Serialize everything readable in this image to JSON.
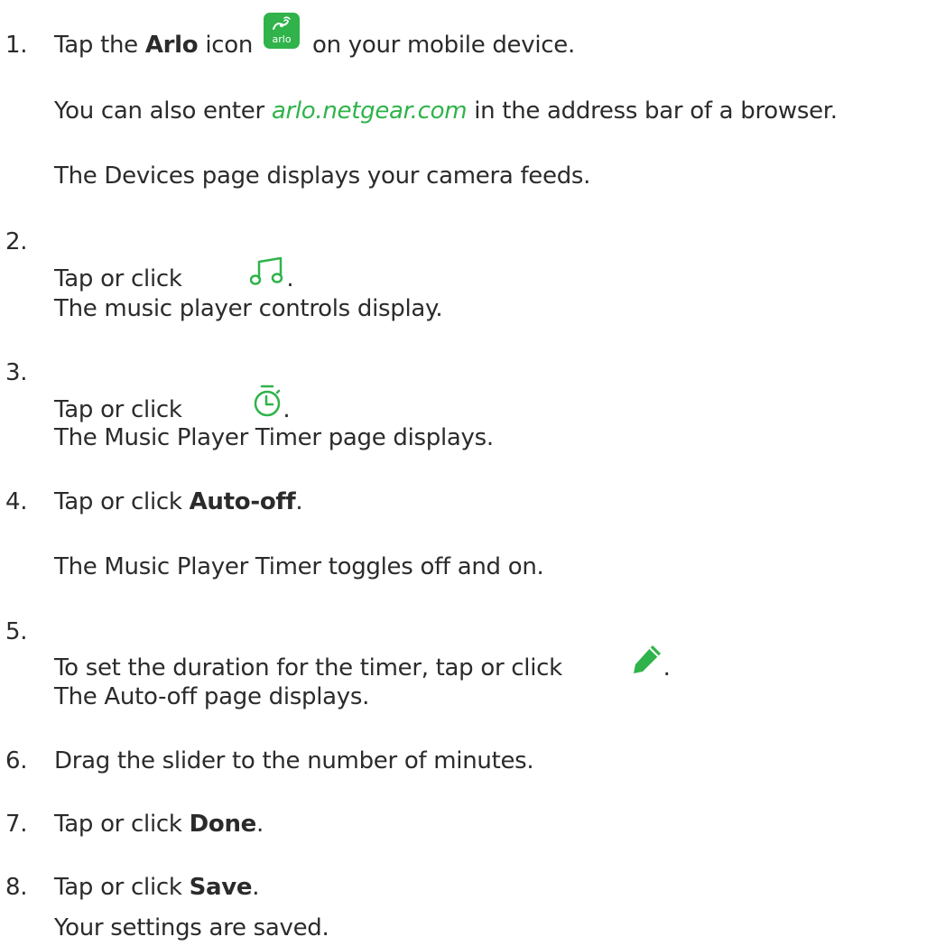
{
  "steps": [
    {
      "number": "1.",
      "pre": "Tap the ",
      "bold": "Arlo",
      "mid": " icon",
      "icon_name": "arlo-app-icon",
      "icon_text": "arlo",
      "post": "on your mobile device.",
      "notes": [
        {
          "pre": "You can also enter ",
          "link": "arlo.netgear.com",
          "post": " in the address bar of a browser."
        },
        {
          "text": "The Devices page displays your camera feeds."
        }
      ]
    },
    {
      "number": "2.",
      "pre": "Tap or click ",
      "icon_name": "music-note-icon",
      "post": ".",
      "notes": [
        {
          "text": "The music player controls display."
        }
      ]
    },
    {
      "number": "3.",
      "pre": "Tap or click ",
      "icon_name": "timer-icon",
      "post": ".",
      "notes": [
        {
          "text": "The Music Player Timer page displays."
        }
      ]
    },
    {
      "number": "4.",
      "pre": "Tap or click ",
      "bold": "Auto-off",
      "post": ".",
      "notes": [
        {
          "text": "The Music Player Timer toggles off and on."
        }
      ]
    },
    {
      "number": "5.",
      "pre": "To set the duration for the timer, tap or click ",
      "icon_name": "pencil-edit-icon",
      "post": ".",
      "notes": [
        {
          "text": "The Auto-off page displays."
        }
      ]
    },
    {
      "number": "6.",
      "pre": "Drag the slider to the number of minutes."
    },
    {
      "number": "7.",
      "pre": "Tap or click ",
      "bold": "Done",
      "post": "."
    },
    {
      "number": "8.",
      "pre": "Tap or click ",
      "bold": "Save",
      "post": ".",
      "notes": [
        {
          "text": "Your settings are saved."
        }
      ]
    }
  ],
  "colors": {
    "accent": "#2fb34a",
    "text": "#2b2b2b"
  }
}
